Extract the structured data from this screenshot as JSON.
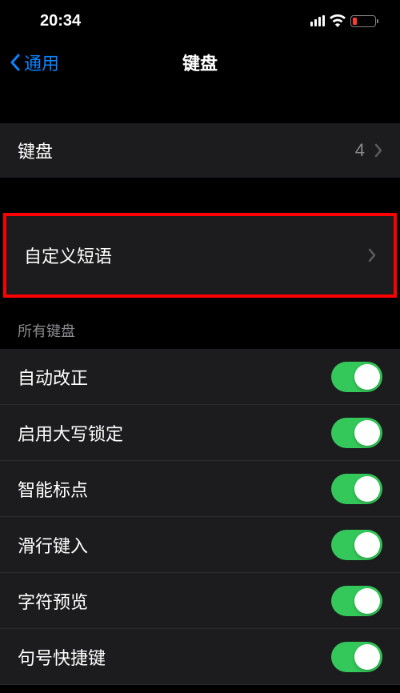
{
  "status": {
    "time": "20:34"
  },
  "nav": {
    "back_label": "通用",
    "title": "键盘"
  },
  "row1": {
    "label": "键盘",
    "value": "4"
  },
  "row2": {
    "label": "自定义短语"
  },
  "section_header": "所有键盘",
  "toggles": {
    "item0": {
      "label": "自动改正",
      "on": true
    },
    "item1": {
      "label": "启用大写锁定",
      "on": true
    },
    "item2": {
      "label": "智能标点",
      "on": true
    },
    "item3": {
      "label": "滑行键入",
      "on": true
    },
    "item4": {
      "label": "字符预览",
      "on": true
    },
    "item5": {
      "label": "句号快捷键",
      "on": true
    }
  }
}
